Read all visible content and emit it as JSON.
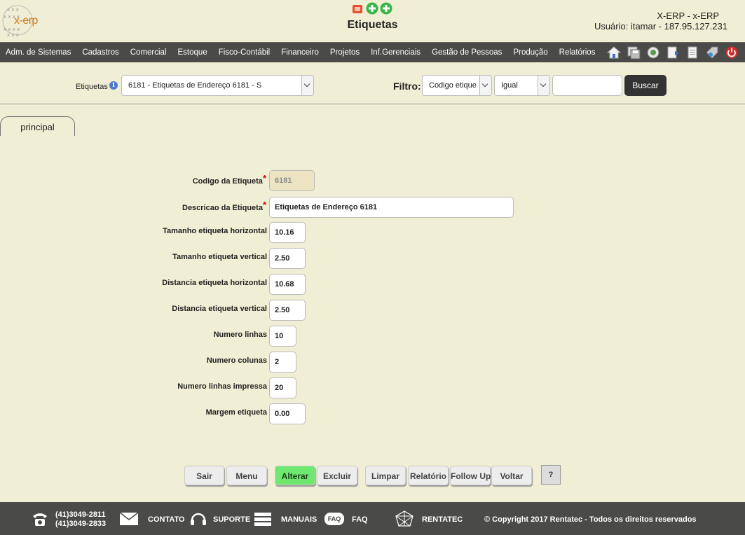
{
  "header": {
    "title": "Etiquetas",
    "system_name": "X-ERP - x-ERP",
    "user_info": "Usuário: itamar - 187.95.127.231",
    "logo_text": "x-erp"
  },
  "menu": {
    "items": [
      "Adm. de Sistemas",
      "Cadastros",
      "Comercial",
      "Estoque",
      "Fisco-Contábil",
      "Financeiro",
      "Projetos",
      "Inf.Gerenciais",
      "Gestão de Pessoas",
      "Produção",
      "Relatórios"
    ]
  },
  "toprow": {
    "etiquetas_label": "Etiquetas",
    "etiquetas_selected": "6181 - Etiquetas de Endereço 6181 - S",
    "filtro_label": "Filtro:",
    "filtro_field": "Codigo etique",
    "filtro_operator": "Igual",
    "filtro_value": "",
    "buscar_label": "Buscar"
  },
  "tabs": [
    {
      "label": "principal"
    }
  ],
  "form": {
    "fields": [
      {
        "label": "Codigo da Etiqueta",
        "value": "6181",
        "required": true
      },
      {
        "label": "Descricao da Etiqueta",
        "value": "Etiquetas de Endereço 6181",
        "required": true
      },
      {
        "label": "Tamanho etiqueta horizontal",
        "value": "10.16"
      },
      {
        "label": "Tamanho etiqueta vertical",
        "value": "2.50"
      },
      {
        "label": "Distancia etiqueta horizontal",
        "value": "10.68"
      },
      {
        "label": "Distancia etiqueta vertical",
        "value": "2.50"
      },
      {
        "label": "Numero linhas",
        "value": "10"
      },
      {
        "label": "Numero colunas",
        "value": "2"
      },
      {
        "label": "Numero linhas impressa",
        "value": "20"
      },
      {
        "label": "Margem etiqueta",
        "value": "0.00"
      }
    ]
  },
  "actions": {
    "sair": "Sair",
    "menu": "Menu",
    "alterar": "Alterar",
    "excluir": "Excluir",
    "limpar": "Limpar",
    "relatorio": "Relatório",
    "followup": "Follow Up",
    "voltar": "Voltar",
    "help": "?"
  },
  "footer": {
    "phone1": "(41)3049-2811",
    "phone2": "(41)3049-2833",
    "contato": "CONTATO",
    "suporte": "SUPORTE",
    "manuais": "MANUAIS",
    "faq_badge": "FAQ",
    "faq": "FAQ",
    "rentatec": "RENTATEC",
    "copyright": "© Copyright 2017 Rentatec - Todos os direitos reservados"
  },
  "colors": {
    "background": "#f0eed4",
    "bar": "#4a4a48",
    "alterar_button": "#6ee86e",
    "required": "#dd0000"
  }
}
